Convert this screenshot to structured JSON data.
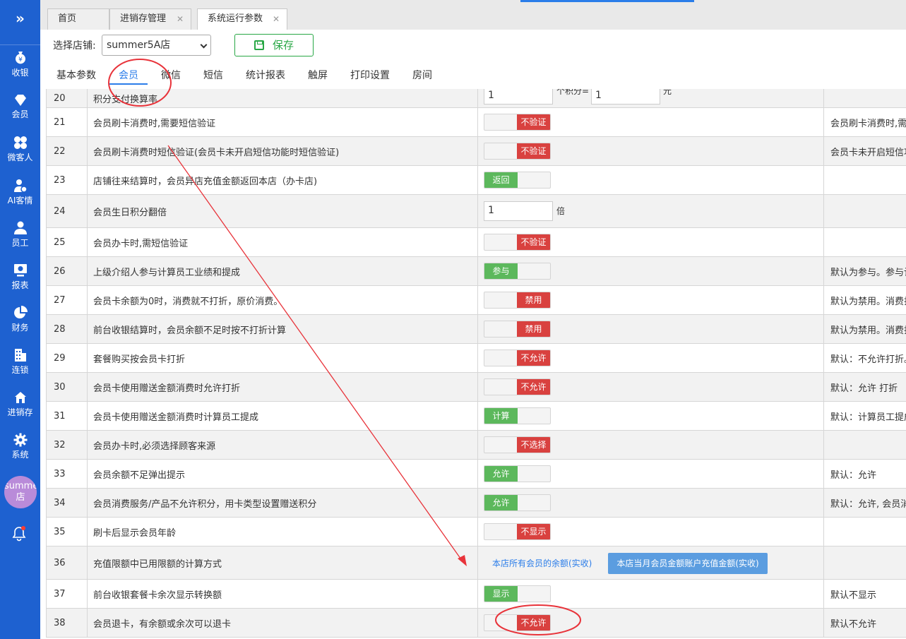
{
  "sidebar": {
    "items": [
      {
        "label": "收银",
        "icon": "yen-bag-icon"
      },
      {
        "label": "会员",
        "icon": "diamond-icon"
      },
      {
        "label": "微客人",
        "icon": "clover-icon"
      },
      {
        "label": "AI客情",
        "icon": "user-heart-icon"
      },
      {
        "label": "员工",
        "icon": "user-icon"
      },
      {
        "label": "报表",
        "icon": "monitor-report-icon"
      },
      {
        "label": "财务",
        "icon": "pie-chart-icon"
      },
      {
        "label": "连锁",
        "icon": "building-icon"
      },
      {
        "label": "进销存",
        "icon": "home-icon"
      },
      {
        "label": "系统",
        "icon": "gear-icon"
      }
    ],
    "store_avatar": "summer5A店"
  },
  "tabs": [
    {
      "label": "首页"
    },
    {
      "label": "进销存管理"
    },
    {
      "label": "系统运行参数"
    }
  ],
  "toolbar": {
    "store_label": "选择店铺:",
    "store_value": "summer5A店",
    "save_label": "保存"
  },
  "subtabs": [
    "基本参数",
    "会员",
    "微信",
    "短信",
    "统计报表",
    "触屏",
    "打印设置",
    "房间"
  ],
  "rows": [
    {
      "num": "20",
      "name": "积分支付换算率",
      "kind": "ratio",
      "a": "1",
      "mid": "个积分=",
      "b": "1",
      "unit": "元",
      "note": ""
    },
    {
      "num": "21",
      "name": "会员刷卡消费时,需要短信验证",
      "kind": "off",
      "text": "不验证",
      "note": "会员刷卡消费时,需要"
    },
    {
      "num": "22",
      "name": "会员刷卡消费时短信验证(会员卡未开启短信功能时短信验证)",
      "kind": "off",
      "text": "不验证",
      "note": "会员卡未开启短信功"
    },
    {
      "num": "23",
      "name": "店铺往来结算时，会员异店充值金额返回本店（办卡店)",
      "kind": "on",
      "text": "返回",
      "note": ""
    },
    {
      "num": "24",
      "name": "会员生日积分翻倍",
      "kind": "input",
      "a": "1",
      "unit": "倍",
      "note": ""
    },
    {
      "num": "25",
      "name": "会员办卡时,需短信验证",
      "kind": "off",
      "text": "不验证",
      "note": ""
    },
    {
      "num": "26",
      "name": "上级介绍人参与计算员工业绩和提成",
      "kind": "on",
      "text": "参与",
      "note": "默认为参与。参与计"
    },
    {
      "num": "27",
      "name": "会员卡余额为0时，消费就不打折，原价消费。",
      "kind": "off",
      "text": "禁用",
      "note": "默认为禁用。消费打"
    },
    {
      "num": "28",
      "name": "前台收银结算时，会员余额不足时按不打折计算",
      "kind": "off",
      "text": "禁用",
      "note": "默认为禁用。消费打"
    },
    {
      "num": "29",
      "name": "套餐购买按会员卡打折",
      "kind": "off",
      "text": "不允许",
      "note": "默认：不允许打折。"
    },
    {
      "num": "30",
      "name": "会员卡使用赠送金额消费时允许打折",
      "kind": "off",
      "text": "不允许",
      "note": "默认：允许 打折"
    },
    {
      "num": "31",
      "name": "会员卡使用赠送金额消费时计算员工提成",
      "kind": "on",
      "text": "计算",
      "note": "默认：计算员工提成"
    },
    {
      "num": "32",
      "name": "会员办卡时,必须选择顾客来源",
      "kind": "off",
      "text": "不选择",
      "note": ""
    },
    {
      "num": "33",
      "name": "会员余额不足弹出提示",
      "kind": "on",
      "text": "允许",
      "note": "默认：允许"
    },
    {
      "num": "34",
      "name": "会员消费服务/产品不允许积分，用卡类型设置赠送积分",
      "kind": "on",
      "text": "允许",
      "note": "默认：允许, 会员消费"
    },
    {
      "num": "35",
      "name": "刷卡后显示会员年龄",
      "kind": "off",
      "text": "不显示",
      "note": ""
    },
    {
      "num": "36",
      "name": "充值限额中已用限额的计算方式",
      "kind": "choice",
      "opt1": "本店所有会员的余额(实收)",
      "opt2": "本店当月会员金额账户充值金额(实收)",
      "note": ""
    },
    {
      "num": "37",
      "name": "前台收银套餐卡余次显示转换额",
      "kind": "on",
      "text": "显示",
      "note": "默认不显示"
    },
    {
      "num": "38",
      "name": "会员退卡，有余额或余次可以退卡",
      "kind": "off",
      "text": "不允许",
      "note": "默认不允许"
    }
  ],
  "colors": {
    "sidebar": "#1e61d0",
    "toggle_on": "#5cb85c",
    "toggle_off": "#d9413f",
    "annotation": "#e8333a",
    "accent": "#2b7de9"
  }
}
